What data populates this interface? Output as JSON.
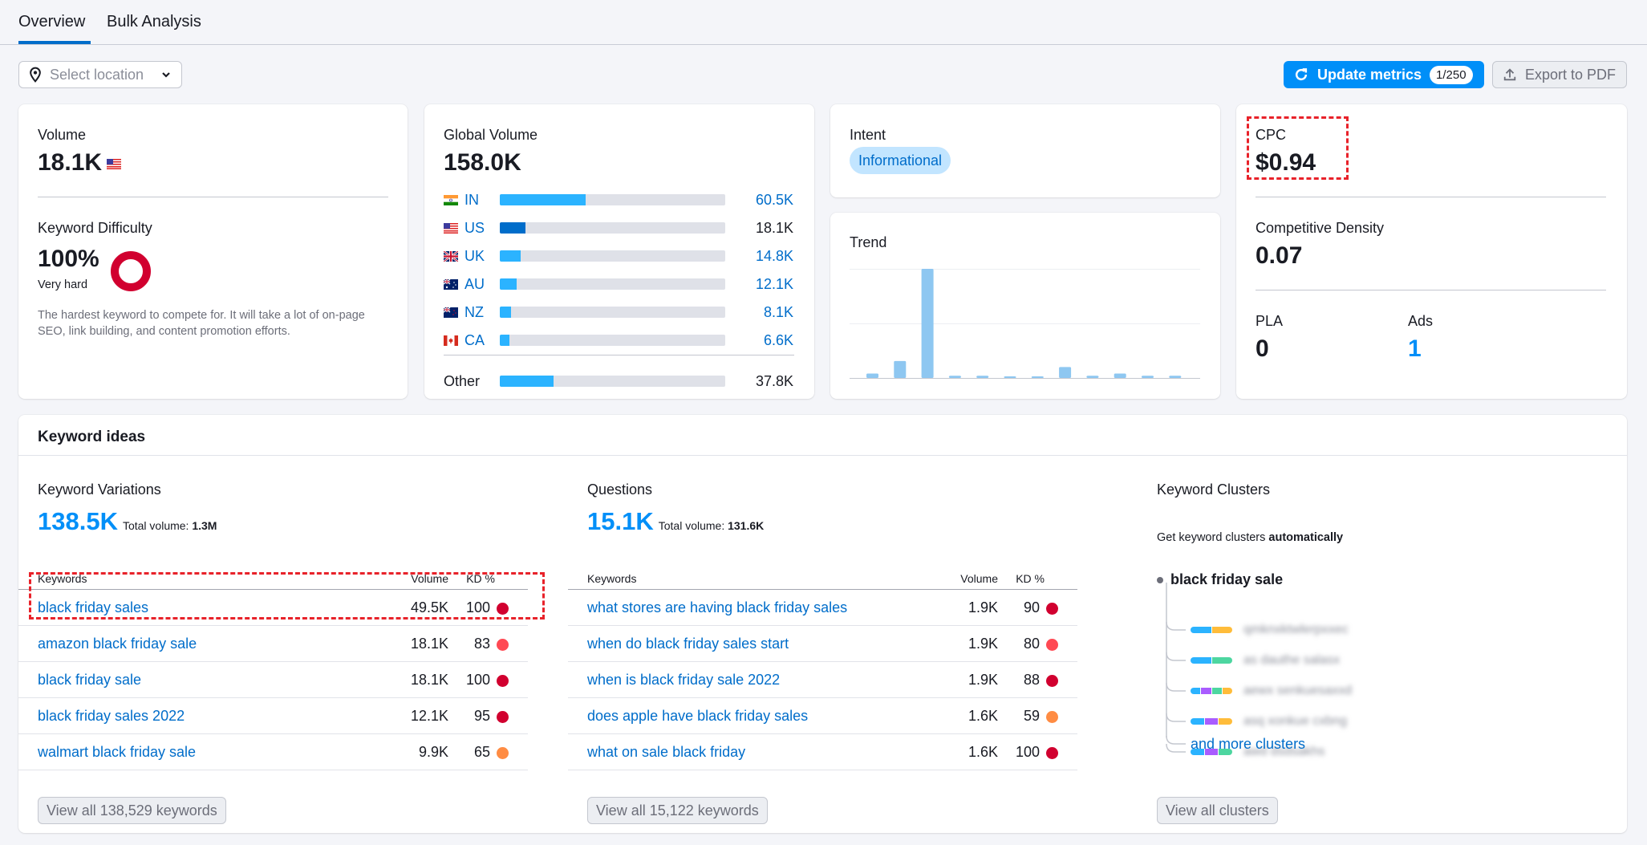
{
  "tabs": [
    {
      "label": "Overview",
      "active": true
    },
    {
      "label": "Bulk Analysis",
      "active": false
    }
  ],
  "toolbar": {
    "location_placeholder": "Select location",
    "update_label": "Update metrics",
    "update_badge": "1/250",
    "export_label": "Export to PDF"
  },
  "colors": {
    "accent": "#008ff8",
    "link": "#006dca",
    "kd_very_hard": "#d1002f",
    "kd_hard": "#ff4953",
    "kd_difficult": "#ff8c43",
    "bar_light": "#2bb3ff",
    "bar_dark": "#006dca",
    "highlight": "#e8222a"
  },
  "volume": {
    "label": "Volume",
    "value": "18.1K",
    "flag": "us-flag-icon"
  },
  "keyword_difficulty": {
    "label": "Keyword Difficulty",
    "value": "100%",
    "level": "Very hard",
    "percent": 100,
    "description": "The hardest keyword to compete for. It will take a lot of on-page SEO, link building, and content promotion efforts."
  },
  "global_volume": {
    "label": "Global Volume",
    "value": "158.0K",
    "countries": [
      {
        "code": "IN",
        "value": "60.5K",
        "fraction": 0.38,
        "link": true
      },
      {
        "code": "US",
        "value": "18.1K",
        "fraction": 0.115,
        "link": false,
        "selected": true
      },
      {
        "code": "UK",
        "value": "14.8K",
        "fraction": 0.093,
        "link": true
      },
      {
        "code": "AU",
        "value": "12.1K",
        "fraction": 0.076,
        "link": true
      },
      {
        "code": "NZ",
        "value": "8.1K",
        "fraction": 0.051,
        "link": true
      },
      {
        "code": "CA",
        "value": "6.6K",
        "fraction": 0.042,
        "link": true
      }
    ],
    "other": {
      "label": "Other",
      "value": "37.8K",
      "fraction": 0.239
    }
  },
  "intent": {
    "label": "Intent",
    "value": "Informational"
  },
  "trend": {
    "label": "Trend",
    "relative_values": [
      0.04,
      0.155,
      1.0,
      0.02,
      0.02,
      0.01,
      0.01,
      0.1,
      0.02,
      0.04,
      0.02,
      0.02
    ]
  },
  "cpc": {
    "label": "CPC",
    "value": "$0.94"
  },
  "competitive_density": {
    "label": "Competitive Density",
    "value": "0.07"
  },
  "pla": {
    "label": "PLA",
    "value": "0"
  },
  "ads": {
    "label": "Ads",
    "value": "1"
  },
  "keyword_ideas": {
    "title": "Keyword ideas",
    "variations": {
      "title": "Keyword Variations",
      "count": "138.5K",
      "total_label": "Total volume:",
      "total_value": "1.3M",
      "headers": {
        "keyword": "Keywords",
        "volume": "Volume",
        "kd": "KD %"
      },
      "rows": [
        {
          "keyword": "black friday sales",
          "volume": "49.5K",
          "kd": "100",
          "kd_color": "#d1002f"
        },
        {
          "keyword": "amazon black friday sale",
          "volume": "18.1K",
          "kd": "83",
          "kd_color": "#ff4953"
        },
        {
          "keyword": "black friday sale",
          "volume": "18.1K",
          "kd": "100",
          "kd_color": "#d1002f"
        },
        {
          "keyword": "black friday sales 2022",
          "volume": "12.1K",
          "kd": "95",
          "kd_color": "#d1002f"
        },
        {
          "keyword": "walmart black friday sale",
          "volume": "9.9K",
          "kd": "65",
          "kd_color": "#ff8c43"
        }
      ],
      "view_all": "View all 138,529 keywords"
    },
    "questions": {
      "title": "Questions",
      "count": "15.1K",
      "total_label": "Total volume:",
      "total_value": "131.6K",
      "headers": {
        "keyword": "Keywords",
        "volume": "Volume",
        "kd": "KD %"
      },
      "rows": [
        {
          "keyword": "what stores are having black friday sales",
          "volume": "1.9K",
          "kd": "90",
          "kd_color": "#d1002f"
        },
        {
          "keyword": "when do black friday sales start",
          "volume": "1.9K",
          "kd": "80",
          "kd_color": "#ff4953"
        },
        {
          "keyword": "when is black friday sale 2022",
          "volume": "1.9K",
          "kd": "88",
          "kd_color": "#d1002f"
        },
        {
          "keyword": "does apple have black friday sales",
          "volume": "1.6K",
          "kd": "59",
          "kd_color": "#ff8c43"
        },
        {
          "keyword": "what on sale black friday",
          "volume": "1.6K",
          "kd": "100",
          "kd_color": "#d1002f"
        }
      ],
      "view_all": "View all 15,122 keywords"
    },
    "clusters": {
      "title": "Keyword Clusters",
      "subtitle_prefix": "Get keyword clusters ",
      "subtitle_bold": "automatically",
      "root": "black friday sale",
      "items": [
        {
          "name": "qmknxktwlerpxxec",
          "segments": [
            "#2bb3ff",
            "#ffbc3a"
          ]
        },
        {
          "name": "as dauthe salasx",
          "segments": [
            "#2bb3ff",
            "#4dd6a0"
          ]
        },
        {
          "name": "aewx senkuesaxxd",
          "segments": [
            "#2bb3ff",
            "#a95cff",
            "#4dd6a0",
            "#ffbc3a"
          ]
        },
        {
          "name": "asq xonkue cxbng",
          "segments": [
            "#2bb3ff",
            "#a95cff",
            "#ffbc3a"
          ]
        },
        {
          "name": "awd dsdsakhs",
          "segments": [
            "#2bb3ff",
            "#a95cff",
            "#4dd6a0"
          ]
        }
      ],
      "more_label": "and more clusters",
      "view_all": "View all clusters"
    }
  }
}
